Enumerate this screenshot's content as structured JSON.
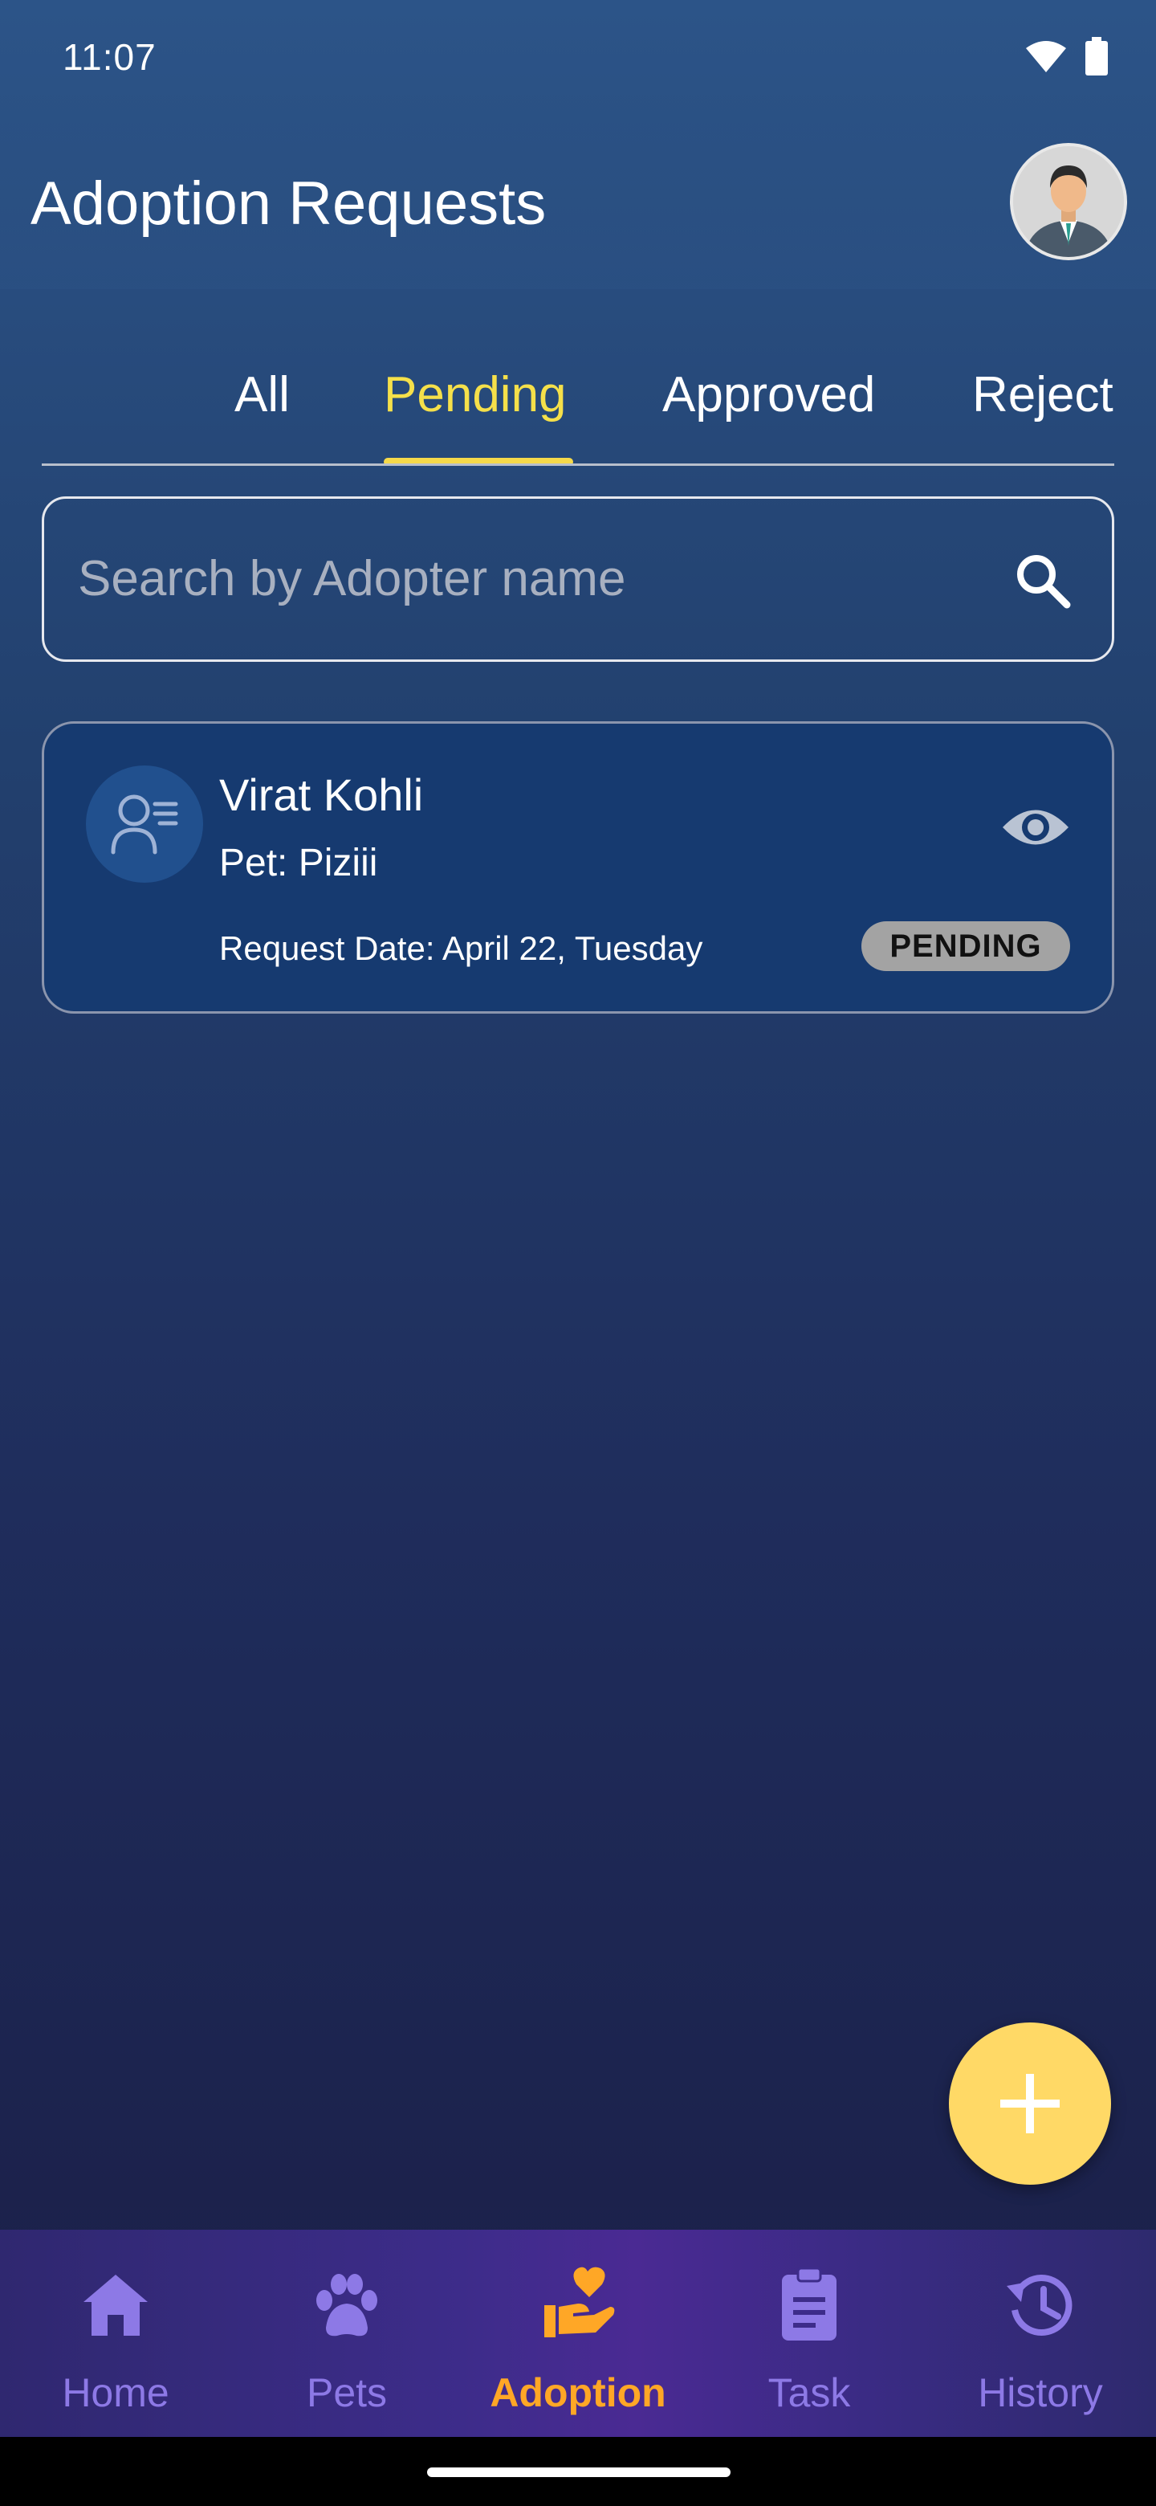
{
  "status_bar": {
    "time": "11:07",
    "icons": [
      "wifi-icon",
      "battery-icon"
    ]
  },
  "header": {
    "title": "Adoption Requests",
    "avatar_icon": "user-avatar"
  },
  "tabs": [
    {
      "label": "All",
      "active": false
    },
    {
      "label": "Pending",
      "active": true
    },
    {
      "label": "Approved",
      "active": false
    },
    {
      "label": "Reject",
      "active": false
    }
  ],
  "search": {
    "placeholder": "Search by Adopter name",
    "value": "",
    "icon": "search-icon"
  },
  "requests": [
    {
      "adopter_name": "Virat Kohli",
      "pet": "Pet: Piziii",
      "request_date": "Request Date: April 22, Tuesday",
      "status": "PENDING",
      "icon": "person-list-icon",
      "action_icon": "eye-icon"
    }
  ],
  "fab": {
    "icon": "plus-icon"
  },
  "bottom_nav": [
    {
      "label": "Home",
      "icon": "home-icon",
      "active": false
    },
    {
      "label": "Pets",
      "icon": "paw-icon",
      "active": false
    },
    {
      "label": "Adoption",
      "icon": "hand-heart-icon",
      "active": true
    },
    {
      "label": "Task",
      "icon": "clipboard-icon",
      "active": false
    },
    {
      "label": "History",
      "icon": "history-icon",
      "active": false
    }
  ],
  "colors": {
    "accent_yellow": "#f5e04a",
    "fab": "#ffd966",
    "nav_active": "#ffa726",
    "nav_inactive": "#8d79e6",
    "card_bg": "#163a70"
  }
}
